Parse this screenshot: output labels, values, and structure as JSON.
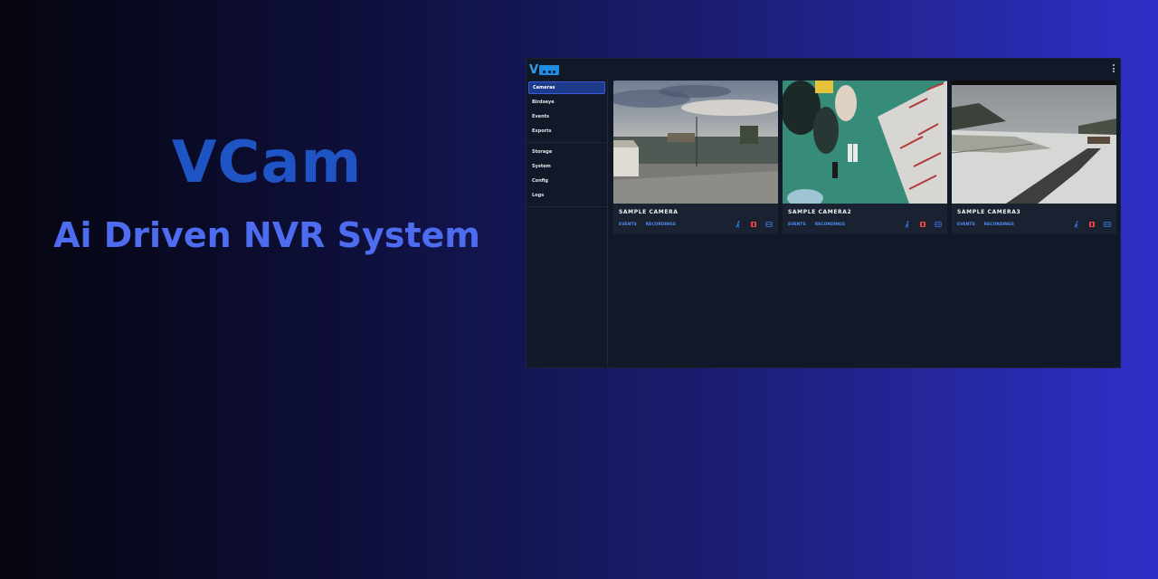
{
  "hero": {
    "title": "VCam",
    "subtitle": "Ai  Driven NVR System"
  },
  "app": {
    "logo_letter": "V",
    "sidebar": {
      "groups": [
        [
          {
            "label": "Cameras",
            "active": true
          },
          {
            "label": "Birdseye"
          },
          {
            "label": "Events"
          },
          {
            "label": "Exports"
          }
        ],
        [
          {
            "label": "Storage"
          },
          {
            "label": "System"
          },
          {
            "label": "Config"
          },
          {
            "label": "Logs"
          }
        ]
      ]
    },
    "cameras": [
      {
        "title": "SAMPLE CAMERA",
        "events_label": "EVENTS",
        "recordings_label": "RECORDINGS"
      },
      {
        "title": "SAMPLE CAMERA2",
        "events_label": "EVENTS",
        "recordings_label": "RECORDINGS"
      },
      {
        "title": "SAMPLE CAMERA3",
        "events_label": "EVENTS",
        "recordings_label": "RECORDINGS"
      }
    ],
    "colors": {
      "accent": "#4f8cf7",
      "motion_icon": "#3b82f6",
      "record_icon": "#ef4444",
      "snapshot_icon": "#3b82f6"
    }
  }
}
